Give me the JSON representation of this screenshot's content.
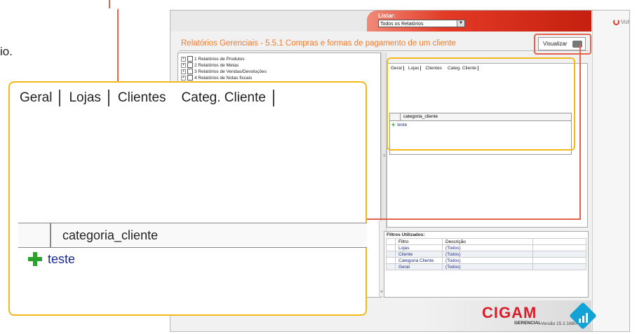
{
  "side_text": "io.",
  "app": {
    "listar_label": "Listar:",
    "listar_value": "Todos os Relatórios",
    "voltar_label": "Voltar",
    "title": "Relatórios Gerenciais - 5.5.1 Compras e formas de pagamento de um cliente",
    "visualizar_label": "Visualizar",
    "tree": [
      "1 Relatórios de Produtos",
      "2 Relatórios de Metas",
      "3 Relatórios de Vendas/Devoluções",
      "4 Relatórios de Notas fiscais"
    ],
    "small_tabs": [
      "Geral",
      "Lojas",
      "Clientes",
      "Categ. Cliente"
    ],
    "small_grid_header": "categoria_cliente",
    "small_grid_row": "teste",
    "filters_title": "Filtros Utilizados:",
    "filters_columns": [
      "Filtro",
      "Descrição"
    ],
    "filters_rows": [
      {
        "filtro": "Lojas",
        "descricao": "(Todos)"
      },
      {
        "filtro": "Cliente",
        "descricao": "(Todos)"
      },
      {
        "filtro": "Categoria Cliente",
        "descricao": "(Todos)"
      },
      {
        "filtro": "Geral",
        "descricao": "(Todos)"
      }
    ],
    "logo_text": "CIGAM",
    "logo_sub": "GERENCIAL",
    "version": "Versão 15.2.1680"
  },
  "zoom": {
    "tabs": [
      "Geral",
      "Lojas",
      "Clientes",
      "Categ. Cliente"
    ],
    "grid_header": "categoria_cliente",
    "grid_row": "teste"
  },
  "colors": {
    "accent_red": "#e23a25",
    "title_orange": "#f07b2e",
    "highlight_yellow": "#f2b81c",
    "link_blue": "#1c2a8a",
    "plus_green": "#2aa12a"
  }
}
